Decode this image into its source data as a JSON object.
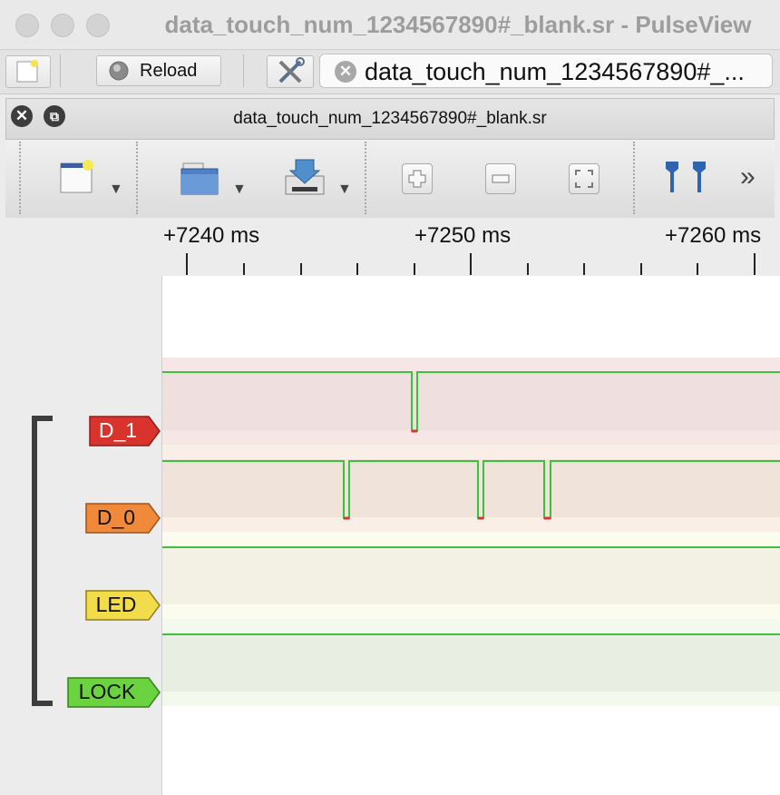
{
  "window": {
    "title": "data_touch_num_1234567890#_blank.sr - PulseView"
  },
  "top_toolbar": {
    "reload_label": "Reload",
    "tab_label": "data_touch_num_1234567890#_..."
  },
  "session": {
    "title": "data_touch_num_1234567890#_blank.sr"
  },
  "ruler": {
    "labels": [
      "+7240 ms",
      "+7250 ms",
      "+7260 ms"
    ]
  },
  "channels": [
    {
      "name": "D_1",
      "color": "#d9332e"
    },
    {
      "name": "D_0",
      "color": "#f08a3a"
    },
    {
      "name": "LED",
      "color": "#f2dc4a"
    },
    {
      "name": "LOCK",
      "color": "#6bd240"
    }
  ],
  "colors": {
    "trace_green": "#3fbf3f",
    "d1_bg": "#f4e1e1",
    "d0_bg": "#f3e6dd",
    "led_bg": "#f3f2e3",
    "lock_bg": "#e9f0e3"
  }
}
